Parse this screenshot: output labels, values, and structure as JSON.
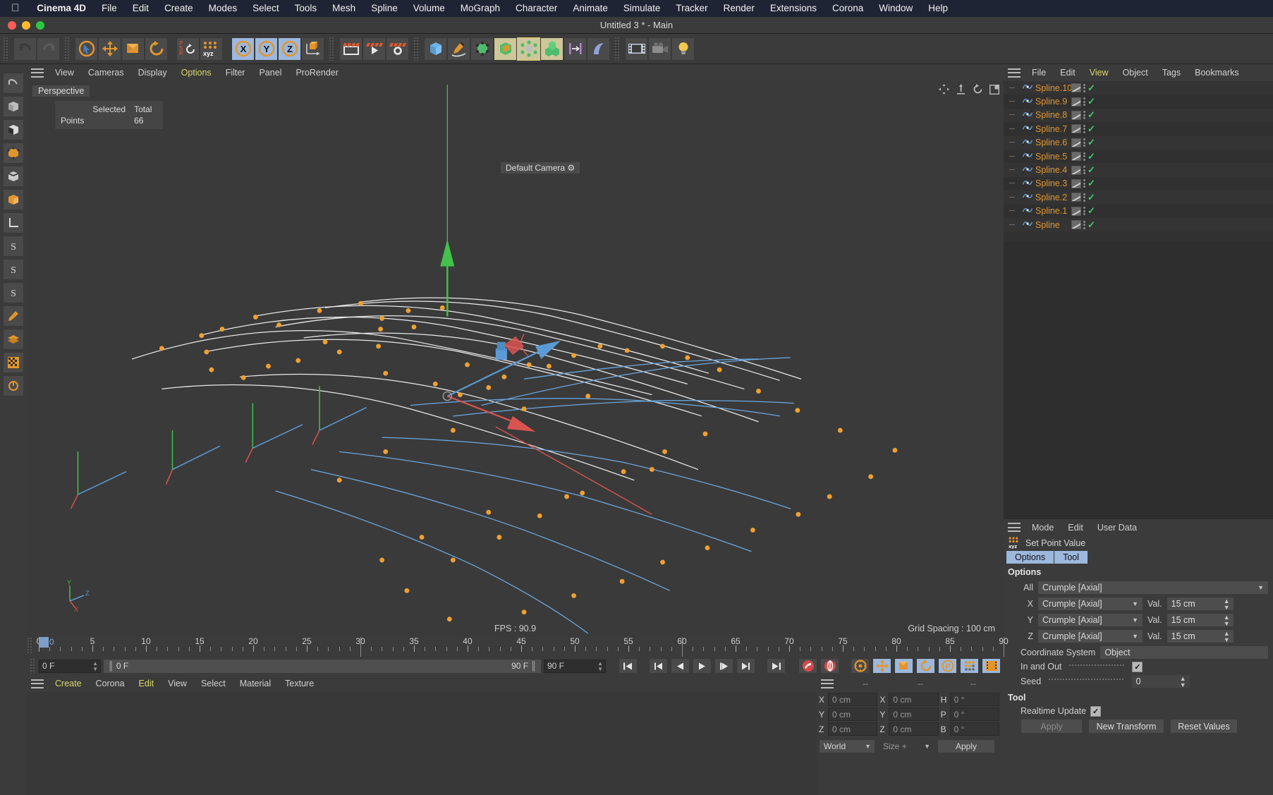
{
  "macmenu": {
    "apple": "apple-logo",
    "items": [
      "Cinema 4D",
      "File",
      "Edit",
      "Create",
      "Modes",
      "Select",
      "Tools",
      "Mesh",
      "Spline",
      "Volume",
      "MoGraph",
      "Character",
      "Animate",
      "Simulate",
      "Tracker",
      "Render",
      "Extensions",
      "Corona",
      "Window",
      "Help"
    ]
  },
  "window": {
    "title": "Untitled 3 * - Main"
  },
  "toolbar": {
    "undo": "undo-icon",
    "redo": "redo-icon",
    "select": "select-tool-icon",
    "move": "move-tool-icon",
    "scale": "scale-tool-icon",
    "rotate": "rotate-tool-icon",
    "psr": "psr-lock-icon",
    "xyz": "world-axis-icon",
    "axis_x": "X",
    "axis_y": "Y",
    "axis_z": "Z",
    "object_axis": "object-axis-icon",
    "render_view": "render-view-icon",
    "render_picture": "render-to-picture-icon",
    "render_settings": "render-settings-icon",
    "cube": "primitive-cube-icon",
    "spline_pen": "spline-pen-icon",
    "nurbs": "generator-icon",
    "deformer": "deformer-icon",
    "environment": "environment-icon",
    "array": "array-icon",
    "motion": "motion-icon",
    "curve": "curve-icon",
    "camera": "camera-icon",
    "film": "film-icon",
    "light": "light-icon"
  },
  "viewport": {
    "menu": [
      "View",
      "Cameras",
      "Display",
      "Options",
      "Filter",
      "Panel",
      "ProRender"
    ],
    "active_menu": "Options",
    "perspective_label": "Perspective",
    "camera_label": "Default Camera",
    "stats": {
      "headers": [
        "Selected",
        "Total"
      ],
      "rows": [
        {
          "label": "Points",
          "selected": "",
          "total": "66"
        }
      ]
    },
    "fps": "FPS : 90.9",
    "grid_spacing": "Grid Spacing : 100 cm",
    "axis_labels": {
      "x": "X",
      "y": "Y",
      "z": "Z"
    },
    "corner_icons": [
      "pan-icon",
      "zoom-icon",
      "rotate-icon",
      "maximize-icon"
    ]
  },
  "timeline": {
    "labels": [
      "0",
      "5",
      "10",
      "15",
      "20",
      "25",
      "30",
      "35",
      "40",
      "45",
      "50",
      "55",
      "60",
      "65",
      "70",
      "75",
      "80",
      "85",
      "90"
    ],
    "values": [
      0,
      5,
      10,
      15,
      20,
      25,
      30,
      35,
      40,
      45,
      50,
      55,
      60,
      65,
      70,
      75,
      80,
      85,
      90
    ],
    "min": 0,
    "max": 90,
    "cursor_label": "0",
    "current_frame": "0 F",
    "preview_start": "0 F",
    "doc_end_right": "90 F",
    "preview_end": "90 F",
    "frame_field_right": "0 F",
    "transport": [
      "go-to-start-icon",
      "previous-keyframe-icon",
      "step-back-icon",
      "play-icon",
      "step-forward-icon",
      "next-keyframe-icon",
      "go-to-end-icon"
    ],
    "record_buttons": [
      "record-active-objects-icon",
      "autokeying-icon",
      "keyframe-settings-icon"
    ],
    "param_buttons": [
      "position-key-icon",
      "scale-key-icon",
      "rotation-key-icon",
      "param-key-icon",
      "point-level-anim-icon",
      "timeline-icon"
    ]
  },
  "material_manager": {
    "menu": [
      "Create",
      "Corona",
      "Edit",
      "View",
      "Select",
      "Material",
      "Texture"
    ],
    "active_menu": [
      "Create",
      "Edit"
    ]
  },
  "coordinates": {
    "headers": [
      "--",
      "--",
      "--"
    ],
    "position": {
      "label_x": "X",
      "label_y": "Y",
      "label_z": "Z",
      "x": "0 cm",
      "y": "0 cm",
      "z": "0 cm"
    },
    "size": {
      "label_x": "X",
      "label_y": "Y",
      "label_z": "Z",
      "x": "0 cm",
      "y": "0 cm",
      "z": "0 cm"
    },
    "rotation": {
      "label_h": "H",
      "label_p": "P",
      "label_b": "B",
      "h": "0 °",
      "p": "0 °",
      "b": "0 °"
    },
    "system": "World",
    "size_mode": "Size +",
    "apply": "Apply"
  },
  "object_manager": {
    "menu": [
      "File",
      "Edit",
      "View",
      "Object",
      "Tags",
      "Bookmarks"
    ],
    "active_menu": "View",
    "objects": [
      {
        "name": "Spline.10"
      },
      {
        "name": "Spline.9"
      },
      {
        "name": "Spline.8"
      },
      {
        "name": "Spline.7"
      },
      {
        "name": "Spline.6"
      },
      {
        "name": "Spline.5"
      },
      {
        "name": "Spline.4"
      },
      {
        "name": "Spline.3"
      },
      {
        "name": "Spline.2"
      },
      {
        "name": "Spline.1"
      },
      {
        "name": "Spline"
      }
    ]
  },
  "attribute_manager": {
    "menu": [
      "Mode",
      "Edit",
      "User Data"
    ],
    "title": "Set Point Value",
    "title_icon": "set-point-value-icon",
    "tabs": [
      "Options",
      "Tool"
    ],
    "sections": {
      "options": "Options",
      "tool": "Tool"
    },
    "all": {
      "label": "All",
      "value": "Crumple [Axial]"
    },
    "axes": [
      {
        "label": "X",
        "mode": "Crumple [Axial]",
        "val_label": "Val.",
        "value": "15 cm"
      },
      {
        "label": "Y",
        "mode": "Crumple [Axial]",
        "val_label": "Val.",
        "value": "15 cm"
      },
      {
        "label": "Z",
        "mode": "Crumple [Axial]",
        "val_label": "Val.",
        "value": "15 cm"
      }
    ],
    "coordinate_system": {
      "label": "Coordinate System",
      "value": "Object"
    },
    "in_and_out": {
      "label": "In and Out",
      "checked": true
    },
    "seed": {
      "label": "Seed",
      "value": "0"
    },
    "realtime_update": {
      "label": "Realtime Update",
      "checked": true
    },
    "buttons": {
      "apply": "Apply",
      "new_transform": "New Transform",
      "reset": "Reset Values"
    }
  },
  "colors": {
    "orange": "#e2952e",
    "accent_blue": "#9cb8dd",
    "green_check": "#3ecf6a",
    "spline_white": "#e9e9e9",
    "spline_blue": "#6ba8e0",
    "point_orange": "#f0a030"
  }
}
